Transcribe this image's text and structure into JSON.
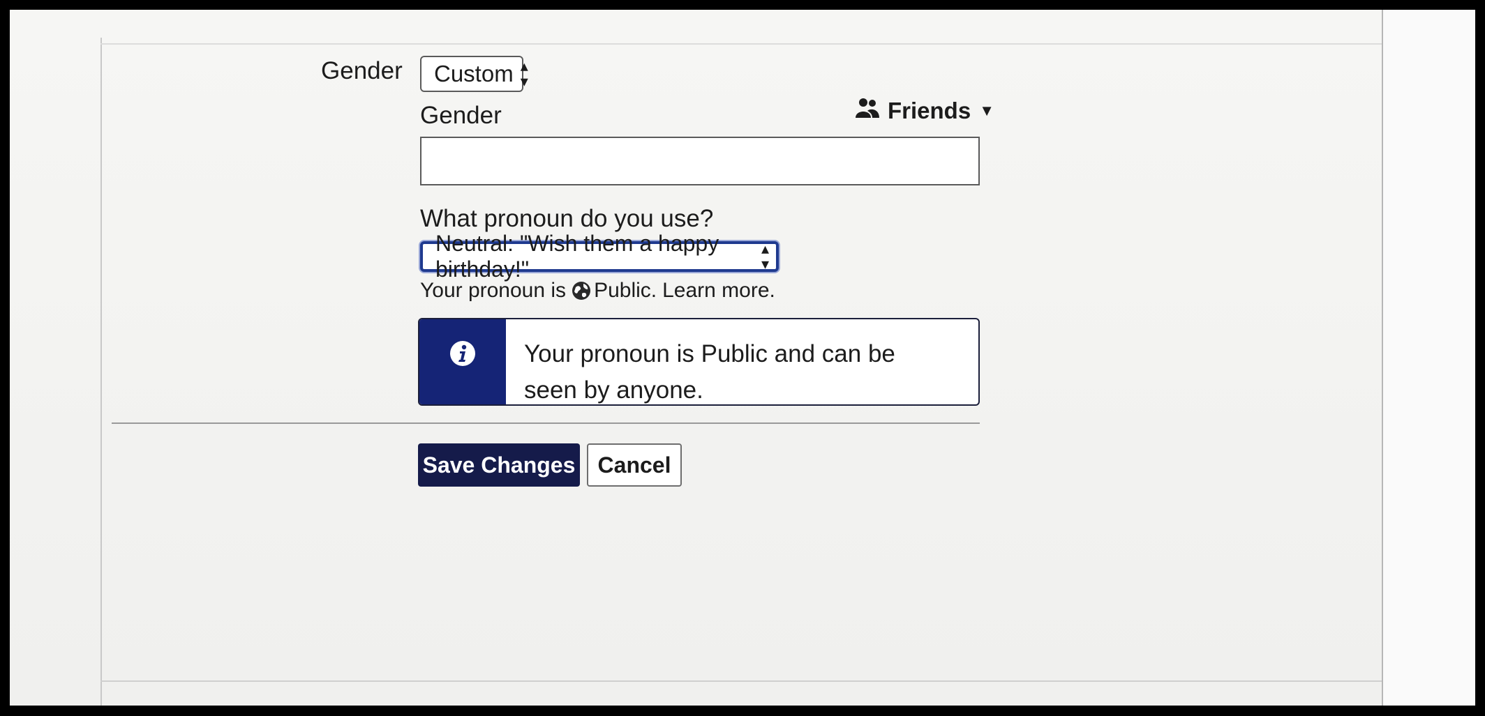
{
  "gender_row": {
    "label": "Gender",
    "select_value": "Custom"
  },
  "custom_gender": {
    "label": "Gender",
    "input_value": "",
    "audience_label": "Friends"
  },
  "pronoun": {
    "question": "What pronoun do you use?",
    "select_value": "Neutral: \"Wish them a happy birthday!\"",
    "visibility_prefix": "Your pronoun is",
    "visibility_value": "Public.",
    "learn_more": "Learn more."
  },
  "notice": {
    "message": "Your pronoun is Public and can be seen by anyone."
  },
  "actions": {
    "save_label": "Save Changes",
    "cancel_label": "Cancel"
  },
  "colors": {
    "accent": "#152476",
    "primary_button": "#151b4a",
    "focus_ring": "#1f3a8f"
  },
  "icons": {
    "audience": "people-icon",
    "dropdown": "caret-down-icon",
    "visibility": "globe-icon",
    "notice": "info-icon"
  }
}
